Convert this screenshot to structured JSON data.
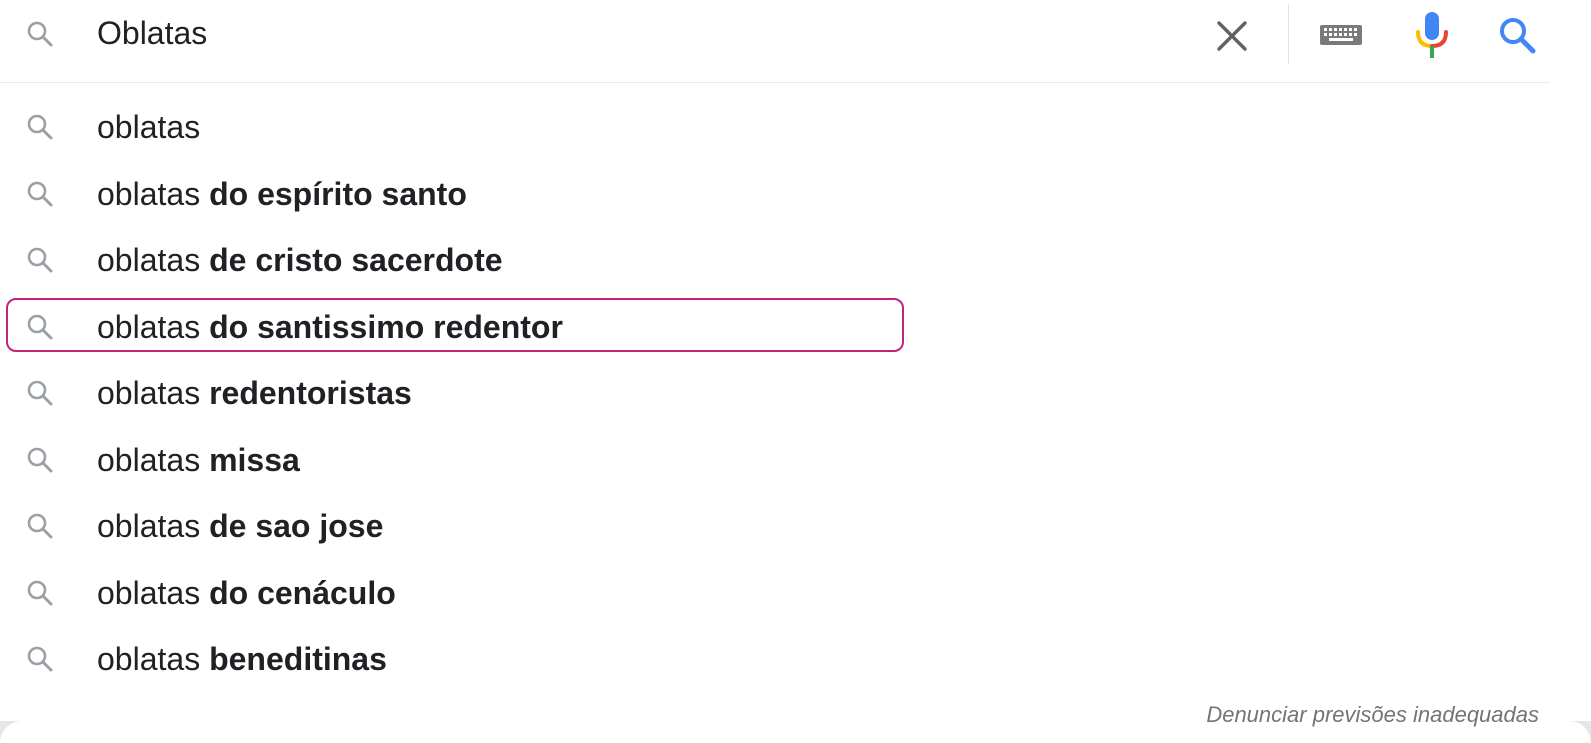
{
  "search": {
    "query": "Oblatas",
    "icons": {
      "leading": "search-icon",
      "clear": "close-icon",
      "keyboard": "keyboard-icon",
      "voice": "microphone-icon",
      "submit": "search-icon"
    }
  },
  "suggestions": [
    {
      "prefix": "oblatas",
      "completion": ""
    },
    {
      "prefix": "oblatas",
      "completion": "do espírito santo"
    },
    {
      "prefix": "oblatas",
      "completion": "de cristo sacerdote"
    },
    {
      "prefix": "oblatas",
      "completion": "do santissimo redentor",
      "highlighted": true
    },
    {
      "prefix": "oblatas",
      "completion": "redentoristas"
    },
    {
      "prefix": "oblatas",
      "completion": "missa"
    },
    {
      "prefix": "oblatas",
      "completion": "de sao jose"
    },
    {
      "prefix": "oblatas",
      "completion": "do cenáculo"
    },
    {
      "prefix": "oblatas",
      "completion": "beneditinas"
    }
  ],
  "footer": {
    "report_link": "Denunciar previsões inadequadas"
  },
  "colors": {
    "text": "#202124",
    "icon_grey": "#9aa0a6",
    "google_blue": "#4285f4",
    "google_red": "#ea4335",
    "google_yellow": "#fbbc04",
    "google_green": "#34a853",
    "highlight_border": "#c4237c",
    "footer_text": "#70757a"
  }
}
